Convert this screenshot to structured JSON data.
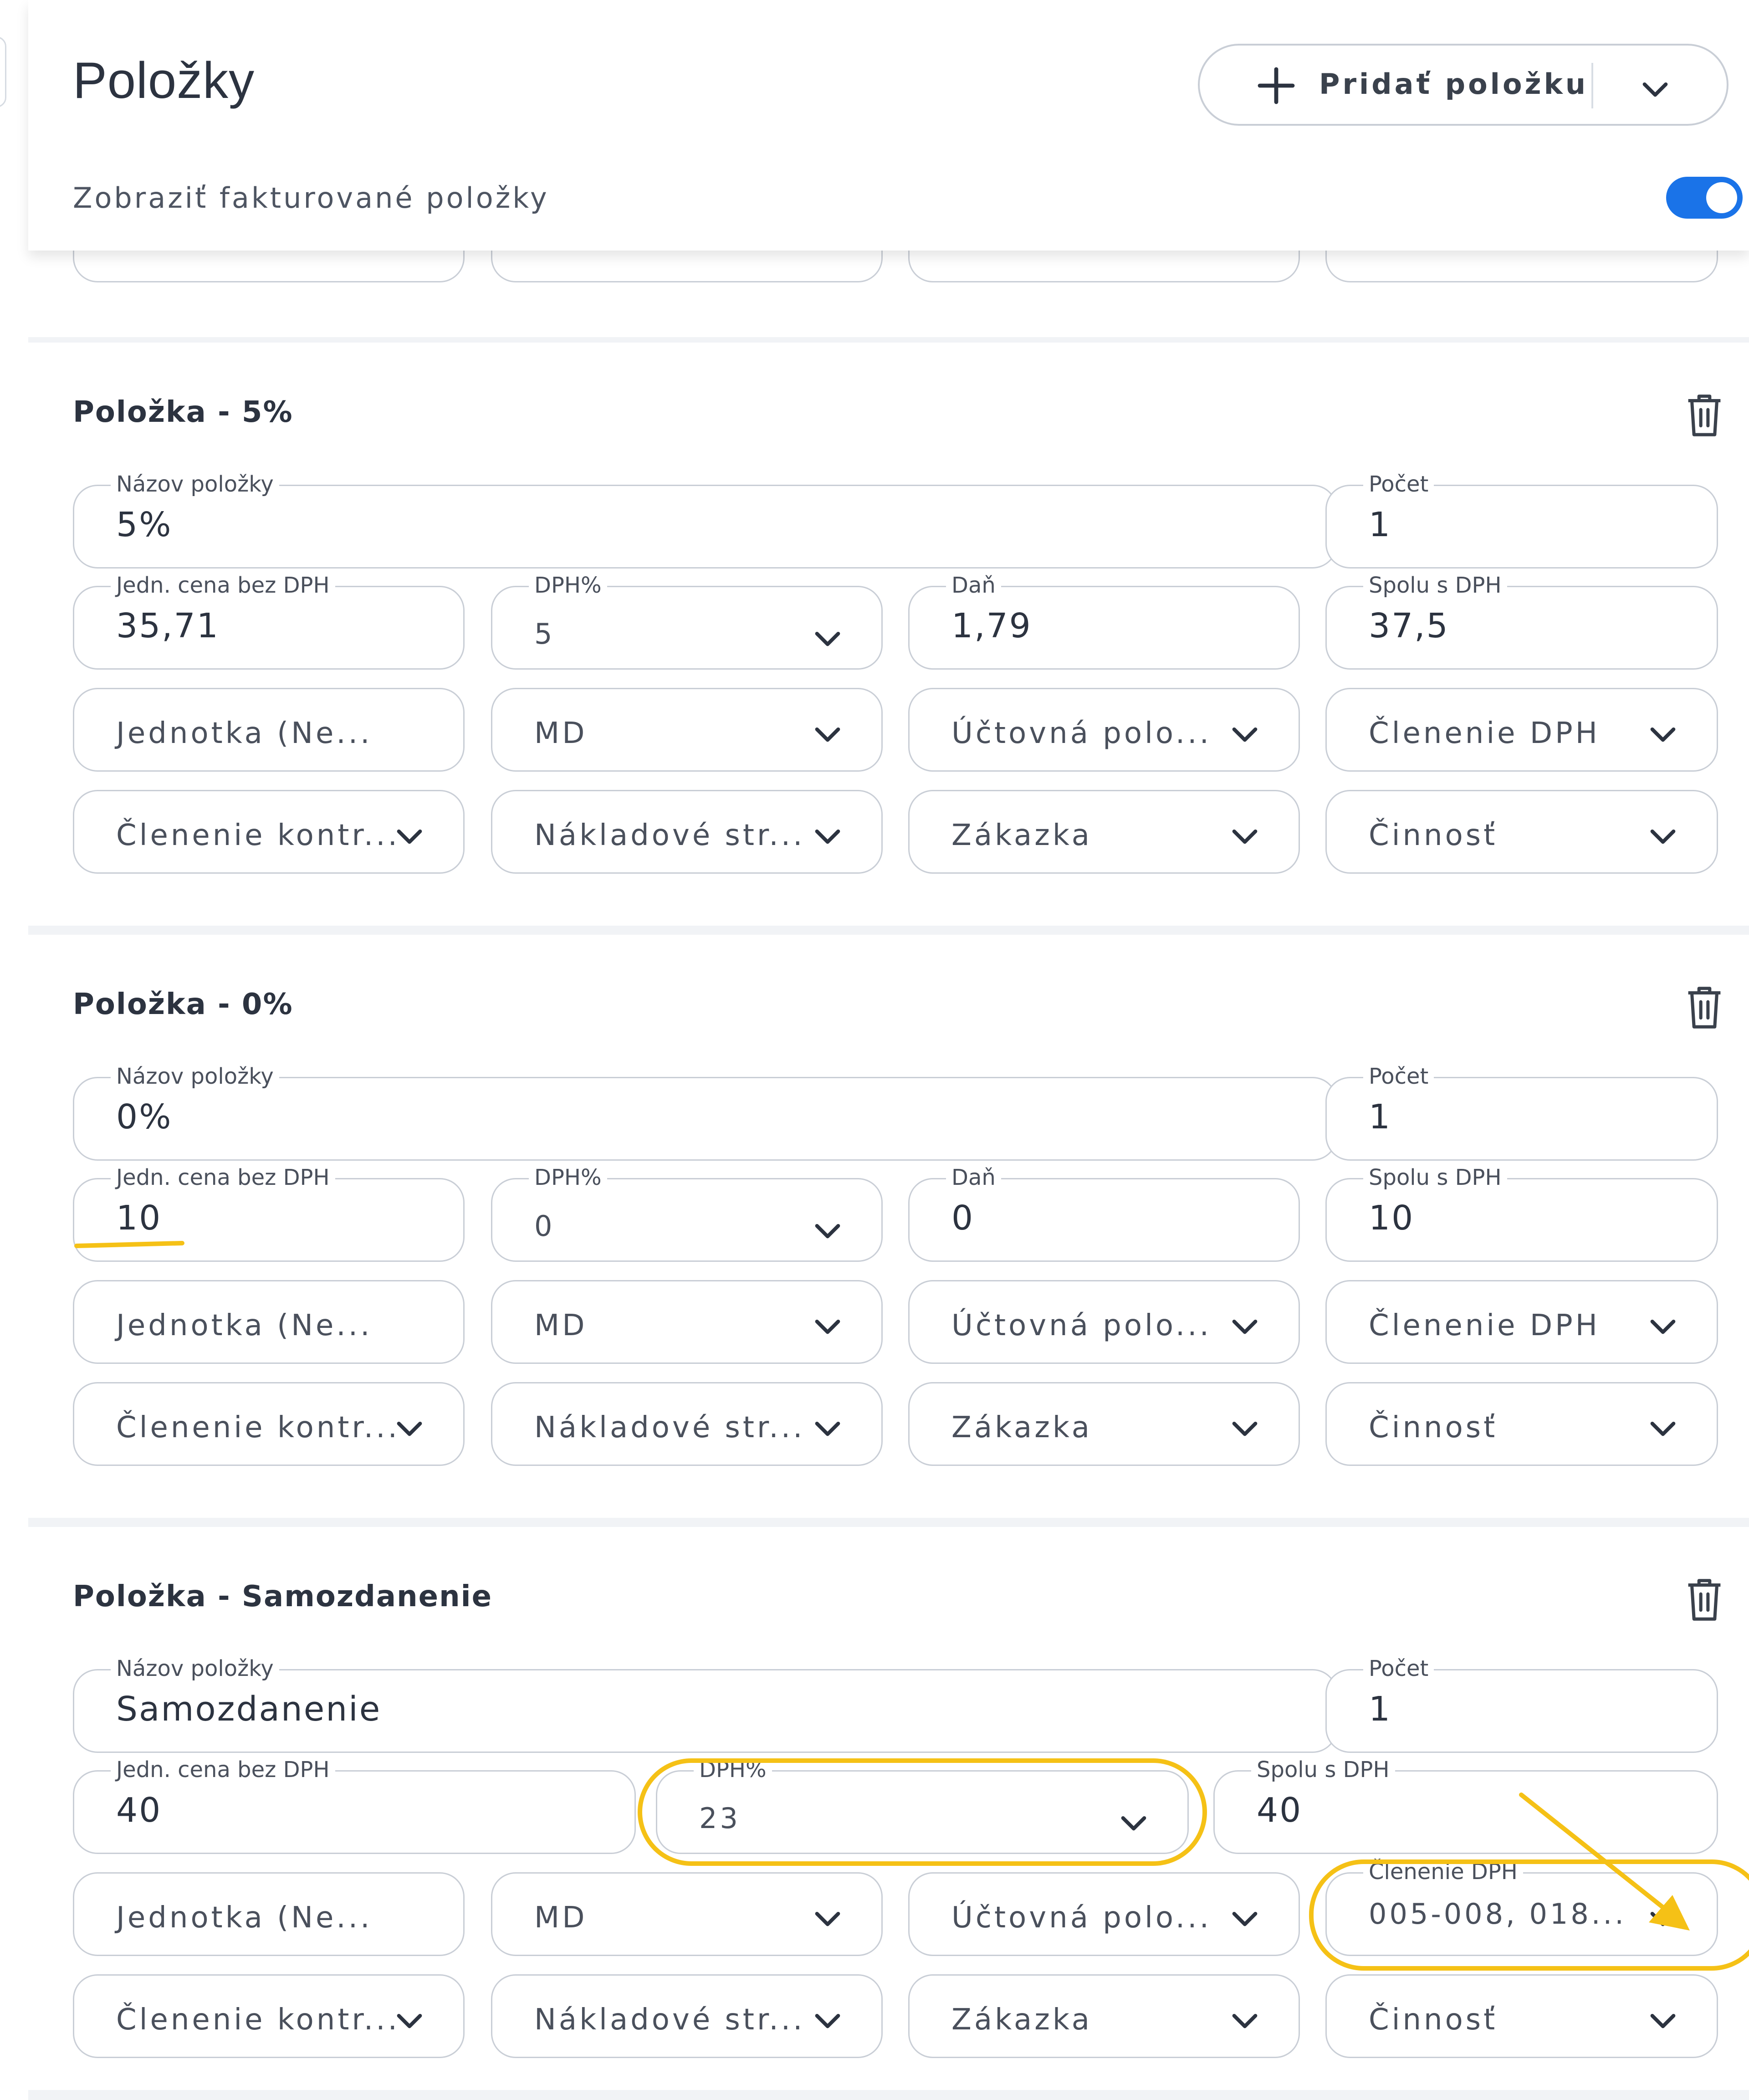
{
  "header": {
    "title": "Položky",
    "add_button_label": "Pridať položku",
    "toggle_label": "Zobraziť fakturované položky",
    "toggle_on": true
  },
  "labels": {
    "name": "Názov položky",
    "count": "Počet",
    "unit_price": "Jedn. cena bez DPH",
    "vat_percent": "DPH%",
    "tax": "Daň",
    "total": "Spolu s DPH",
    "vat_breakdown": "Členenie DPH"
  },
  "placeholders": {
    "unit": "Jednotka (Ne...",
    "md": "MD",
    "account": "Účtovná polo...",
    "vat_breakdown": "Členenie DPH",
    "control_breakdown": "Členenie kontr...",
    "cost_center": "Nákladové str...",
    "order": "Zákazka",
    "activity": "Činnosť"
  },
  "items": [
    {
      "title": "Položka - 5%",
      "name": "5%",
      "count": "1",
      "unit_price": "35,71",
      "vat_percent": "5",
      "tax": "1,79",
      "total": "37,5"
    },
    {
      "title": "Položka - 0%",
      "name": "0%",
      "count": "1",
      "unit_price": "10",
      "vat_percent": "0",
      "tax": "0",
      "total": "10"
    },
    {
      "title": "Položka - Samozdanenie",
      "name": "Samozdanenie",
      "count": "1",
      "unit_price": "40",
      "vat_percent": "23",
      "total": "40",
      "vat_breakdown_value": "005-008, 018..."
    }
  ],
  "colors": {
    "accent": "#1a73e8",
    "annotation": "#f5c116",
    "border": "#c9ced6",
    "text": "#2c3340"
  },
  "icons": [
    "plus-icon",
    "chevron-down-icon",
    "trash-icon"
  ]
}
